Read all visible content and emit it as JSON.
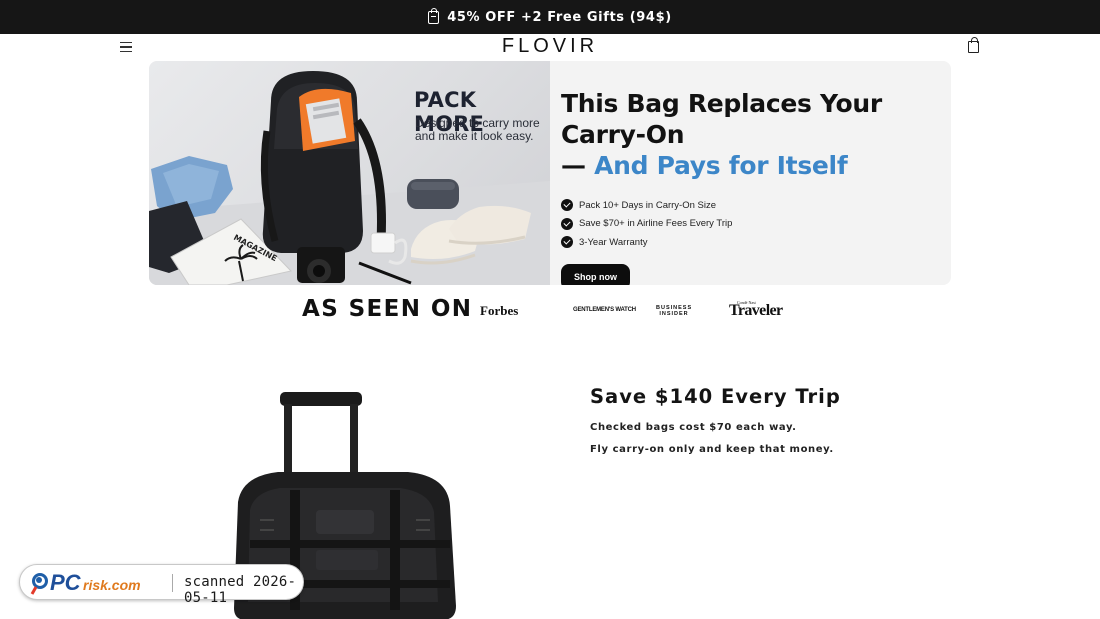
{
  "announcement": {
    "text": "45% OFF +2 Free Gifts (94$)",
    "icon": "gift-icon"
  },
  "header": {
    "logo": "FLOVIR",
    "menu_icon": "hamburger-menu-icon",
    "cart_icon": "shopping-bag-icon"
  },
  "hero": {
    "image": {
      "title": "PACK MORE",
      "subtitle": "Designed to carry more and make it look easy.",
      "magazine_label": "MAGAZINE"
    },
    "headline_part1": "This Bag Replaces Your Carry-On",
    "headline_dash": "—",
    "headline_part2": "And Pays for Itself",
    "bullets": [
      "Pack 10+ Days in Carry-On Size",
      "Save $70+ in Airline Fees Every Trip",
      "3-Year Warranty"
    ],
    "cta_label": "Shop now"
  },
  "press": {
    "heading": "AS SEEN ON",
    "logos": [
      "Forbes",
      "GENTLEMEN'S WATCH",
      "BUSINESS INSIDER",
      "Traveler"
    ],
    "traveler_small": "Condé Nast"
  },
  "savings": {
    "title": "Save $140 Every Trip",
    "line1": "Checked bags cost $70 each way.",
    "line2": "Fly carry-on only and keep that money."
  },
  "watermark": {
    "brand": "PCrisk.com",
    "scanned": "scanned 2026-05-11"
  },
  "colors": {
    "accent": "#3c86c8",
    "announcement_bg": "#161616",
    "hero_bg": "#f3f3f3",
    "orange": "#f07a2a"
  }
}
